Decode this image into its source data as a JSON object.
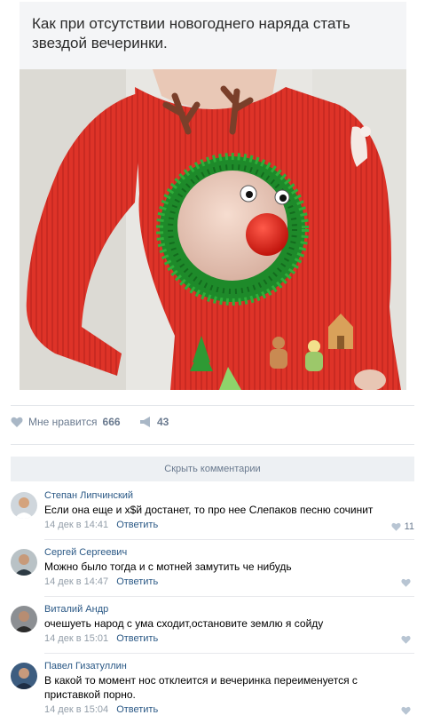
{
  "post": {
    "text": "Как при отсутствии новогоднего наряда стать звездой вечеринки."
  },
  "actions": {
    "like_label": "Мне нравится",
    "like_count": "666",
    "share_count": "43"
  },
  "hide_comments_label": "Скрыть комментарии",
  "comments": [
    {
      "author": "Степан Липчинский",
      "text": "Если она еще и х$й достанет, то про нее Слепаков песню сочинит",
      "time": "14 дек в 14:41",
      "reply": "Ответить",
      "likes": "11"
    },
    {
      "author": "Сергей Сергеевич",
      "text": "Можно было тогда и с мотней замутить че нибудь",
      "time": "14 дек в 14:47",
      "reply": "Ответить",
      "likes": ""
    },
    {
      "author": "Виталий Андр",
      "text": "очешуеть народ с ума сходит,остановите землю я сойду",
      "time": "14 дек в 15:01",
      "reply": "Ответить",
      "likes": ""
    },
    {
      "author": "Павел Гизатуллин",
      "text": "В какой то момент нос отклеится и вечеринка переименуется с приставкой порно.",
      "time": "14 дек в 15:04",
      "reply": "Ответить",
      "likes": ""
    }
  ],
  "colors": {
    "link": "#2a5885",
    "muted": "#939ea9",
    "sweater": "#e0342a",
    "tinsel": "#1e8a2a"
  }
}
